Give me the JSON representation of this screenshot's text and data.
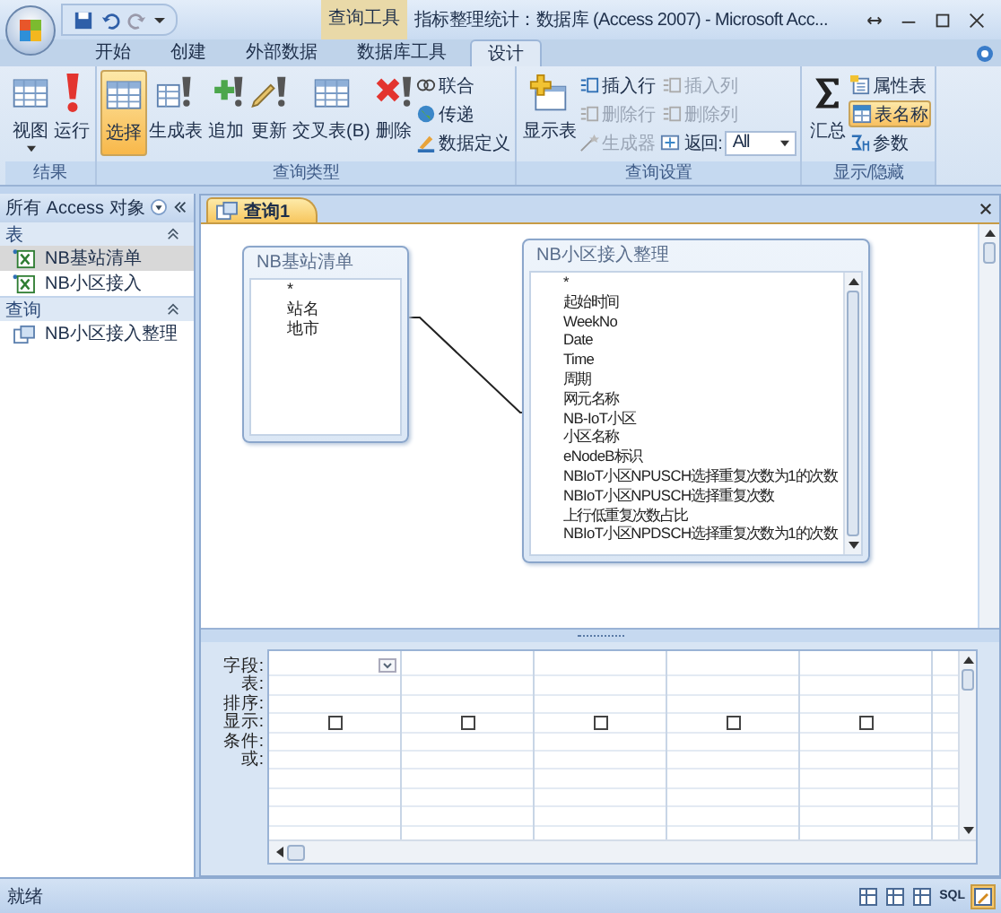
{
  "title_bar": {
    "contextual_tab": "查询工具",
    "title": "指标整理统计：数据库 (Access 2007) - Microsoft Acc..."
  },
  "ribbon": {
    "tabs": [
      {
        "label": "开始",
        "selected": false
      },
      {
        "label": "创建",
        "selected": false
      },
      {
        "label": "外部数据",
        "selected": false
      },
      {
        "label": "数据库工具",
        "selected": false
      },
      {
        "label": "设计",
        "selected": true
      }
    ],
    "groups": [
      {
        "label": "结果",
        "items": [
          {
            "kind": "large",
            "label": "视图",
            "has_menu": true,
            "selected": false,
            "disabled": false
          },
          {
            "kind": "large",
            "label": "运行",
            "selected": false,
            "disabled": false
          }
        ]
      },
      {
        "label": "查询类型",
        "items": [
          {
            "kind": "large",
            "label": "选择",
            "selected": true,
            "disabled": false
          },
          {
            "kind": "large",
            "label": "生成表",
            "selected": false,
            "disabled": false
          },
          {
            "kind": "large",
            "label": "追加",
            "selected": false,
            "disabled": false
          },
          {
            "kind": "large",
            "label": "更新",
            "selected": false,
            "disabled": false
          },
          {
            "kind": "large",
            "label": "交叉表(B)",
            "selected": false,
            "disabled": false
          },
          {
            "kind": "large",
            "label": "删除",
            "selected": false,
            "disabled": false
          },
          {
            "kind": "small",
            "label": "联合",
            "selected": false,
            "disabled": false
          },
          {
            "kind": "small",
            "label": "传递",
            "selected": false,
            "disabled": false
          },
          {
            "kind": "small",
            "label": "数据定义",
            "selected": false,
            "disabled": false
          }
        ]
      },
      {
        "label": "查询设置",
        "items": [
          {
            "kind": "large",
            "label": "显示表",
            "selected": false,
            "disabled": false
          },
          {
            "kind": "small",
            "label": "插入行",
            "selected": false,
            "disabled": false
          },
          {
            "kind": "small",
            "label": "插入列",
            "selected": false,
            "disabled": true
          },
          {
            "kind": "small",
            "label": "删除行",
            "selected": false,
            "disabled": true
          },
          {
            "kind": "small",
            "label": "删除列",
            "selected": false,
            "disabled": true
          },
          {
            "kind": "small",
            "label": "生成器",
            "selected": false,
            "disabled": true
          },
          {
            "kind": "combo",
            "label": "返回:",
            "value": "All",
            "selected": false,
            "disabled": false
          }
        ]
      },
      {
        "label": "显示/隐藏",
        "items": [
          {
            "kind": "large",
            "label": "汇总",
            "selected": false,
            "disabled": false
          },
          {
            "kind": "small",
            "label": "属性表",
            "selected": false,
            "disabled": false
          },
          {
            "kind": "small",
            "label": "表名称",
            "selected": true,
            "disabled": false
          },
          {
            "kind": "small",
            "label": "参数",
            "selected": false,
            "disabled": false
          }
        ]
      }
    ]
  },
  "nav_pane": {
    "header": "所有 Access 对象",
    "sections": [
      {
        "label": "表",
        "expanded": true,
        "items": [
          {
            "label": "NB基站清单",
            "kind": "table",
            "selected": true
          },
          {
            "label": "NB小区接入",
            "kind": "table",
            "selected": false
          }
        ]
      },
      {
        "label": "查询",
        "expanded": true,
        "items": [
          {
            "label": "NB小区接入整理",
            "kind": "query",
            "selected": false
          }
        ]
      }
    ]
  },
  "document_tabs": [
    {
      "label": "查询1",
      "selected": true
    }
  ],
  "query_tables": [
    {
      "title": "NB基站清单",
      "fields": [
        "*",
        "站名",
        "地市"
      ]
    },
    {
      "title": "NB小区接入整理",
      "fields": [
        "*",
        "起始时间",
        "WeekNo",
        "Date",
        "Time",
        "周期",
        "网元名称",
        "NB-IoT小区",
        "小区名称",
        "eNodeB标识",
        "NBIoT小区NPUSCH选择重复次数为1的次数",
        "NBIoT小区NPUSCH选择重复次数",
        "上行低重复次数占比",
        "NBIoT小区NPDSCH选择重复次数为1的次数"
      ]
    }
  ],
  "grid": {
    "row_labels": [
      "字段:",
      "表:",
      "排序:",
      "显示:",
      "条件:",
      "或:"
    ],
    "columns": [
      {
        "show_checked": false
      },
      {
        "show_checked": false
      },
      {
        "show_checked": false
      },
      {
        "show_checked": false
      },
      {
        "show_checked": false
      }
    ]
  },
  "status_bar": {
    "text": "就绪",
    "views": [
      {
        "selected": false
      },
      {
        "selected": false
      },
      {
        "selected": false
      },
      {
        "label": "SQL",
        "selected": false
      },
      {
        "selected": true
      }
    ]
  }
}
